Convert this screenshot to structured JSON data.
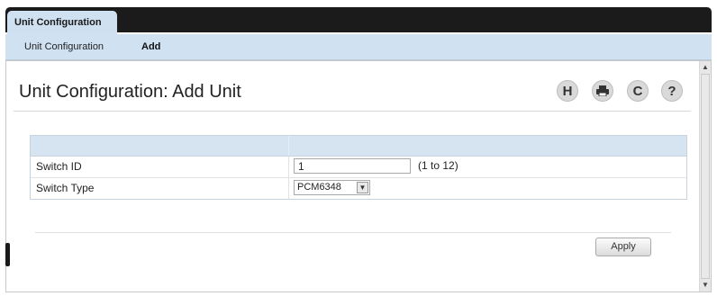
{
  "tabs": {
    "active_label": "Unit Configuration"
  },
  "subnav": {
    "items": [
      {
        "label": "Unit Configuration"
      },
      {
        "label": "Add"
      }
    ]
  },
  "page": {
    "title": "Unit Configuration: Add Unit"
  },
  "toolbar": {
    "save_icon": "H",
    "print_icon": "printer-icon",
    "refresh_icon": "C",
    "help_icon": "?"
  },
  "form": {
    "rows": [
      {
        "label": "Switch ID",
        "value": "1",
        "hint": "(1 to 12)"
      },
      {
        "label": "Switch Type",
        "value": "PCM6348"
      }
    ]
  },
  "actions": {
    "apply_label": "Apply"
  }
}
